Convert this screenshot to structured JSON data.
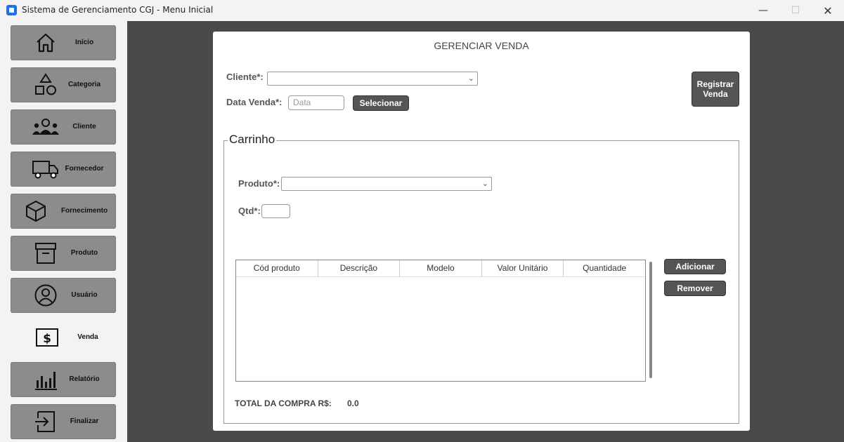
{
  "window": {
    "title": "Sistema de Gerenciamento CGJ - Menu Inicial",
    "minimize_glyph": "—",
    "maximize_glyph": "☐",
    "close_glyph": "✕"
  },
  "sidebar": {
    "items": [
      {
        "label": "Início",
        "icon": "home-icon"
      },
      {
        "label": "Categoria",
        "icon": "shapes-icon"
      },
      {
        "label": "Cliente",
        "icon": "users-icon"
      },
      {
        "label": "Fornecedor",
        "icon": "truck-icon"
      },
      {
        "label": "Fornecimento",
        "icon": "box-icon"
      },
      {
        "label": "Produto",
        "icon": "archive-icon"
      },
      {
        "label": "Usuário",
        "icon": "user-circle-icon"
      },
      {
        "label": "Venda",
        "icon": "dollar-icon",
        "active": true
      },
      {
        "label": "Relatório",
        "icon": "bar-chart-icon"
      },
      {
        "label": "Finalizar",
        "icon": "exit-icon"
      }
    ]
  },
  "form": {
    "title": "GERENCIAR VENDA",
    "cliente_label": "Cliente*:",
    "cliente_value": "",
    "data_venda_label": "Data Venda*:",
    "data_placeholder": "Data",
    "selecionar_label": "Selecionar",
    "registrar_label": "Registrar Venda"
  },
  "cart": {
    "title": "Carrinho",
    "produto_label": "Produto*:",
    "produto_value": "",
    "qtd_label": "Qtd*:",
    "qtd_value": "",
    "columns": [
      "Cód produto",
      "Descrição",
      "Modelo",
      "Valor Unitário",
      "Quantidade"
    ],
    "rows": [],
    "adicionar_label": "Adicionar",
    "remover_label": "Remover",
    "total_label": "TOTAL DA COMPRA R$:",
    "total_value": "0.0"
  },
  "colors": {
    "accent": "#1a73e8",
    "nav_button": "#8c8c8c",
    "main_bg": "#4a4a4a",
    "dark_button": "#555555"
  }
}
